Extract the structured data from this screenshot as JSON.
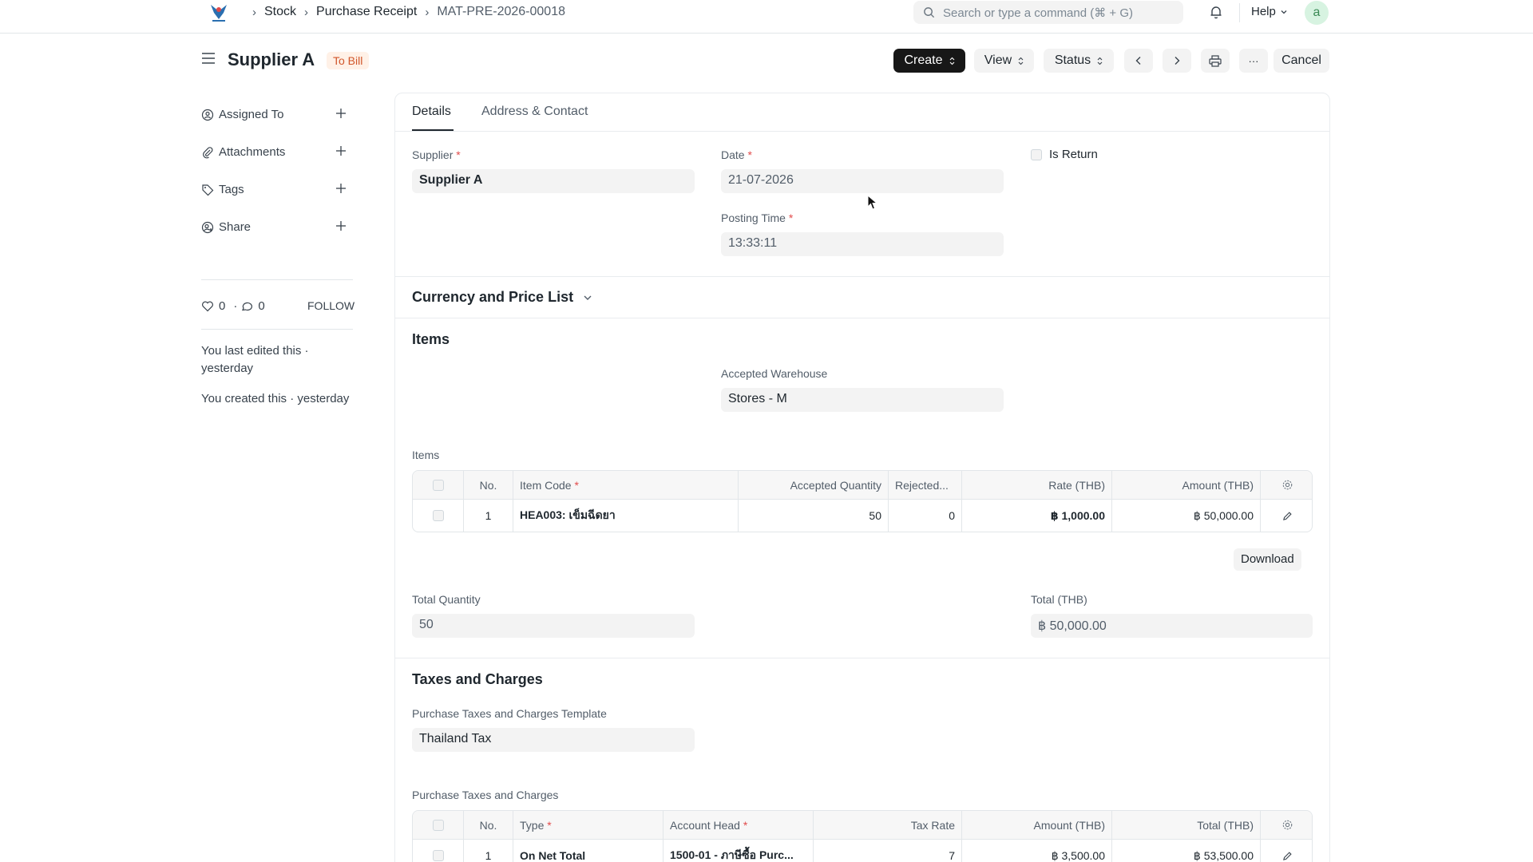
{
  "navbar": {
    "breadcrumbs": [
      "Stock",
      "Purchase Receipt",
      "MAT-PRE-2026-00018"
    ],
    "search_placeholder": "Search or type a command (⌘ + G)",
    "help_label": "Help",
    "avatar_letter": "a"
  },
  "header": {
    "title": "Supplier A",
    "status": "To Bill",
    "buttons": {
      "create": "Create",
      "view": "View",
      "status": "Status",
      "more": "···",
      "cancel": "Cancel"
    }
  },
  "sidebar": {
    "items": [
      {
        "label": "Assigned To",
        "icon": "assign-icon"
      },
      {
        "label": "Attachments",
        "icon": "paperclip-icon"
      },
      {
        "label": "Tags",
        "icon": "tag-icon"
      },
      {
        "label": "Share",
        "icon": "share-icon"
      }
    ],
    "likes": "0",
    "comments": "0",
    "follow": "FOLLOW",
    "last_edited_1": "You last edited this ·",
    "last_edited_2": "yesterday",
    "created": "You created this · yesterday"
  },
  "tabs": [
    "Details",
    "Address & Contact"
  ],
  "form": {
    "supplier_label": "Supplier",
    "supplier_value": "Supplier A",
    "date_label": "Date",
    "date_value": "21-07-2026",
    "posting_time_label": "Posting Time",
    "posting_time_value": "13:33:11",
    "is_return_label": "Is Return",
    "currency_section": "Currency and Price List",
    "items_section": "Items",
    "accepted_warehouse_label": "Accepted Warehouse",
    "accepted_warehouse_value": "Stores - M",
    "items_table_label": "Items",
    "total_qty_label": "Total Quantity",
    "total_qty_value": "50",
    "total_label": "Total (THB)",
    "total_value": "฿ 50,000.00",
    "download": "Download",
    "taxes_section": "Taxes and Charges",
    "tax_template_label": "Purchase Taxes and Charges Template",
    "tax_template_value": "Thailand Tax",
    "taxes_table_label": "Purchase Taxes and Charges"
  },
  "items_table": {
    "headers": [
      "No.",
      "Item Code",
      "Accepted Quantity",
      "Rejected...",
      "Rate (THB)",
      "Amount (THB)"
    ],
    "rows": [
      {
        "no": "1",
        "item_code": "HEA003: เข็มฉีดยา",
        "accepted_qty": "50",
        "rejected": "0",
        "rate": "฿ 1,000.00",
        "amount": "฿ 50,000.00"
      }
    ]
  },
  "taxes_table": {
    "headers": [
      "No.",
      "Type",
      "Account Head",
      "Tax Rate",
      "Amount (THB)",
      "Total (THB)"
    ],
    "rows": [
      {
        "no": "1",
        "type": "On Net Total",
        "account_head": "1500-01 - ภาษีซื้อ Purc...",
        "tax_rate": "7",
        "amount": "฿ 3,500.00",
        "total": "฿ 53,500.00"
      }
    ]
  }
}
